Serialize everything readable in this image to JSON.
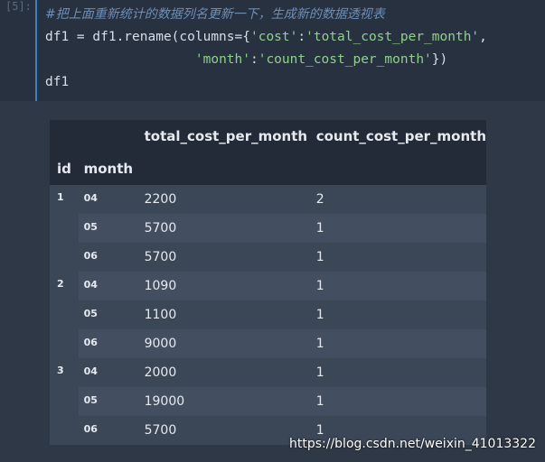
{
  "cell": {
    "prompt": "[5]:",
    "comment": "#把上面重新统计的数据列名更新一下，生成新的数据透视表",
    "line1_a": "df1 = df1.rename(columns={",
    "line1_s1": "'cost'",
    "line1_b": ":",
    "line1_s2": "'total_cost_per_month'",
    "line1_c": ",",
    "line2_pad": "                   ",
    "line2_s1": "'month'",
    "line2_b": ":",
    "line2_s2": "'count_cost_per_month'",
    "line2_c": "})",
    "line3": "df1"
  },
  "table": {
    "columns": [
      "total_cost_per_month",
      "count_cost_per_month"
    ],
    "index_names": [
      "id",
      "month"
    ],
    "rows": [
      {
        "id": "1",
        "month": "04",
        "total": "2200",
        "count": "2"
      },
      {
        "id": "",
        "month": "05",
        "total": "5700",
        "count": "1"
      },
      {
        "id": "",
        "month": "06",
        "total": "5700",
        "count": "1"
      },
      {
        "id": "2",
        "month": "04",
        "total": "1090",
        "count": "1"
      },
      {
        "id": "",
        "month": "05",
        "total": "1100",
        "count": "1"
      },
      {
        "id": "",
        "month": "06",
        "total": "9000",
        "count": "1"
      },
      {
        "id": "3",
        "month": "04",
        "total": "2000",
        "count": "1"
      },
      {
        "id": "",
        "month": "05",
        "total": "19000",
        "count": "1"
      },
      {
        "id": "",
        "month": "06",
        "total": "5700",
        "count": "1"
      }
    ]
  },
  "watermark": "https://blog.csdn.net/weixin_41013322"
}
